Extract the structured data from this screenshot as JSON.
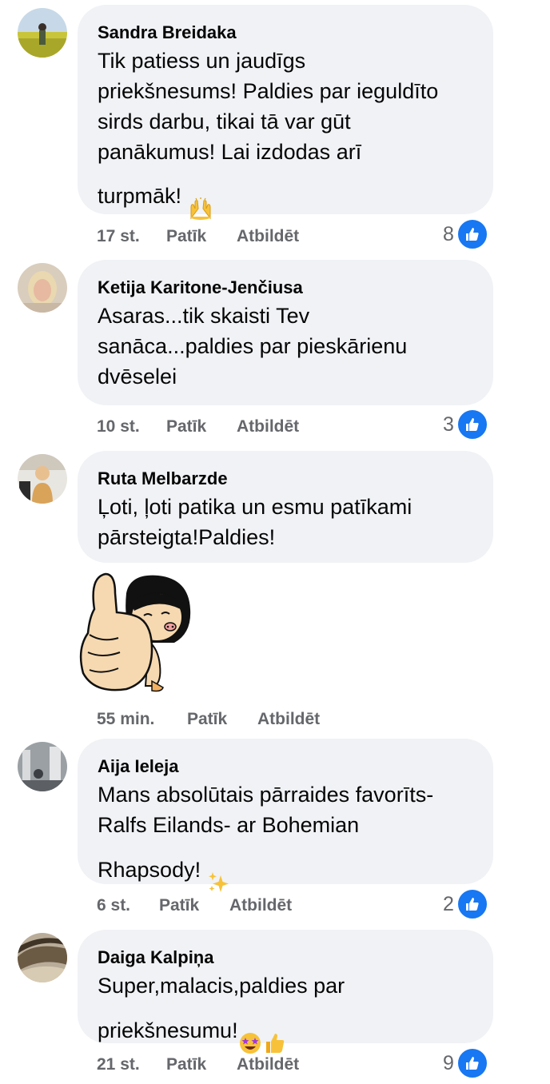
{
  "comments": [
    {
      "author": "Sandra Breidaka",
      "text": "Tik patiess un jaudīgs\npriekšnesums! Paldies par ieguldīto\nsirds darbu, tikai tā var gūt\npanākumus! Lai izdodas arī\nturpmāk!",
      "emoji": "raised-hands",
      "time": "17 st.",
      "like_label": "Patīk",
      "reply_label": "Atbildēt",
      "reaction_count": "8"
    },
    {
      "author": "Ketija Karitone-Jenčiusa",
      "text": "Asaras...tik skaisti Tev\nsanāca...paldies par pieskārienu\ndvēselei",
      "time": "10 st.",
      "like_label": "Patīk",
      "reply_label": "Atbildēt",
      "reaction_count": "3"
    },
    {
      "author": "Ruta Melbarzde",
      "text": "Ļoti, ļoti patika un esmu patīkami\npārsteigta!Paldies!",
      "sticker": "thumbs-up-girl-sticker",
      "time": "55 min.",
      "like_label": "Patīk",
      "reply_label": "Atbildēt"
    },
    {
      "author": "Aija Ieleja",
      "text": "Mans absolūtais pārraides favorīts-\nRalfs Eilands- ar Bohemian\nRhapsody!",
      "emoji": "sparkles",
      "time": "6 st.",
      "like_label": "Patīk",
      "reply_label": "Atbildēt",
      "reaction_count": "2"
    },
    {
      "author": "Daiga Kalpiņa",
      "text": "Super,malacis,paldies par\npriekšnesumu!",
      "emoji": "star-struck, thumbs-up",
      "time": "21 st.",
      "like_label": "Patīk",
      "reply_label": "Atbildēt",
      "reaction_count": "9"
    }
  ],
  "colors": {
    "bubble": "#f0f2f5",
    "meta_text": "#65676b",
    "like_blue": "#1877f2"
  }
}
